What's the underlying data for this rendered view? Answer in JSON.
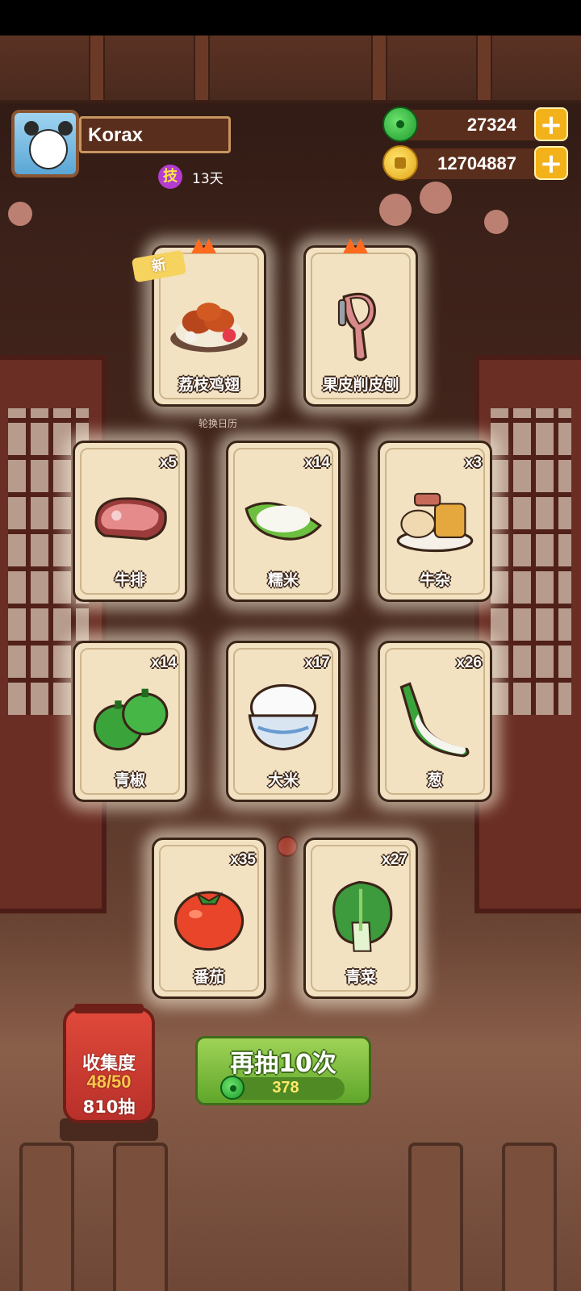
{
  "player": {
    "name": "Korax",
    "skill_glyph": "技",
    "days": "13天"
  },
  "currencies": {
    "jade": "27324",
    "coins": "12704887"
  },
  "new_badge": "新",
  "calendar_hint": "轮换日历",
  "cards": [
    {
      "name": "荔枝鸡翅",
      "qty": "",
      "is_new": true
    },
    {
      "name": "果皮削皮刨",
      "qty": ""
    },
    {
      "name": "牛排",
      "qty": "x5"
    },
    {
      "name": "糯米",
      "qty": "x14"
    },
    {
      "name": "牛杂",
      "qty": "x3"
    },
    {
      "name": "青椒",
      "qty": "x14"
    },
    {
      "name": "大米",
      "qty": "x17"
    },
    {
      "name": "葱",
      "qty": "x26"
    },
    {
      "name": "番茄",
      "qty": "x35"
    },
    {
      "name": "青菜",
      "qty": "x27"
    }
  ],
  "collection": {
    "title": "收集度",
    "progress": "48/50",
    "draws": "810抽"
  },
  "draw_button": {
    "label": "再抽10次",
    "cost": "378"
  },
  "icons": {
    "jade": "jade-icon",
    "coin": "coin-icon",
    "plus": "plus-icon"
  }
}
